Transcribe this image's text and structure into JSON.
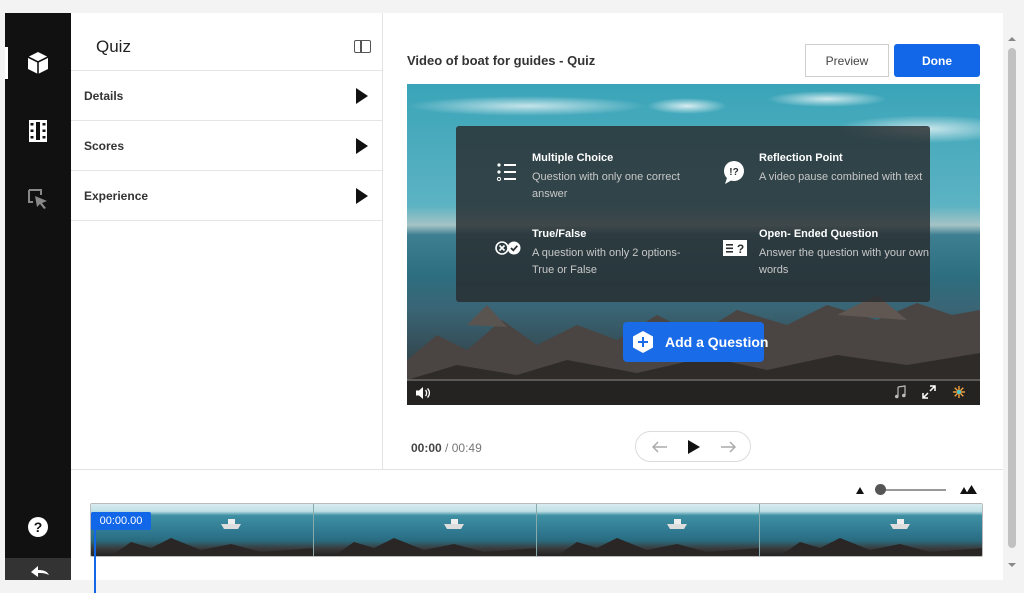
{
  "sidebar_panel": {
    "title": "Quiz",
    "sections": [
      {
        "label": "Details"
      },
      {
        "label": "Scores"
      },
      {
        "label": "Experience"
      }
    ]
  },
  "header": {
    "video_title": "Video of boat for guides - Quiz",
    "preview_label": "Preview",
    "done_label": "Done"
  },
  "question_types": [
    {
      "title": "Multiple Choice",
      "desc": "Question with only one correct answer",
      "icon": "list-icon"
    },
    {
      "title": "Reflection Point",
      "desc": "A video pause combined with text",
      "icon": "reflection-icon"
    },
    {
      "title": "True/False",
      "desc": "A question with only 2 options- True or False",
      "icon": "true-false-icon"
    },
    {
      "title": "Open- Ended Question",
      "desc": "Answer the question with your own words",
      "icon": "open-ended-icon"
    }
  ],
  "add_question_label": "Add a Question",
  "playback": {
    "current_time": "00:00",
    "separator": "/",
    "duration": "00:49"
  },
  "timeline": {
    "timestamp": "00:00.00",
    "thumbnail_count": 4
  },
  "colors": {
    "accent": "#1167e8",
    "rail": "#111111"
  }
}
